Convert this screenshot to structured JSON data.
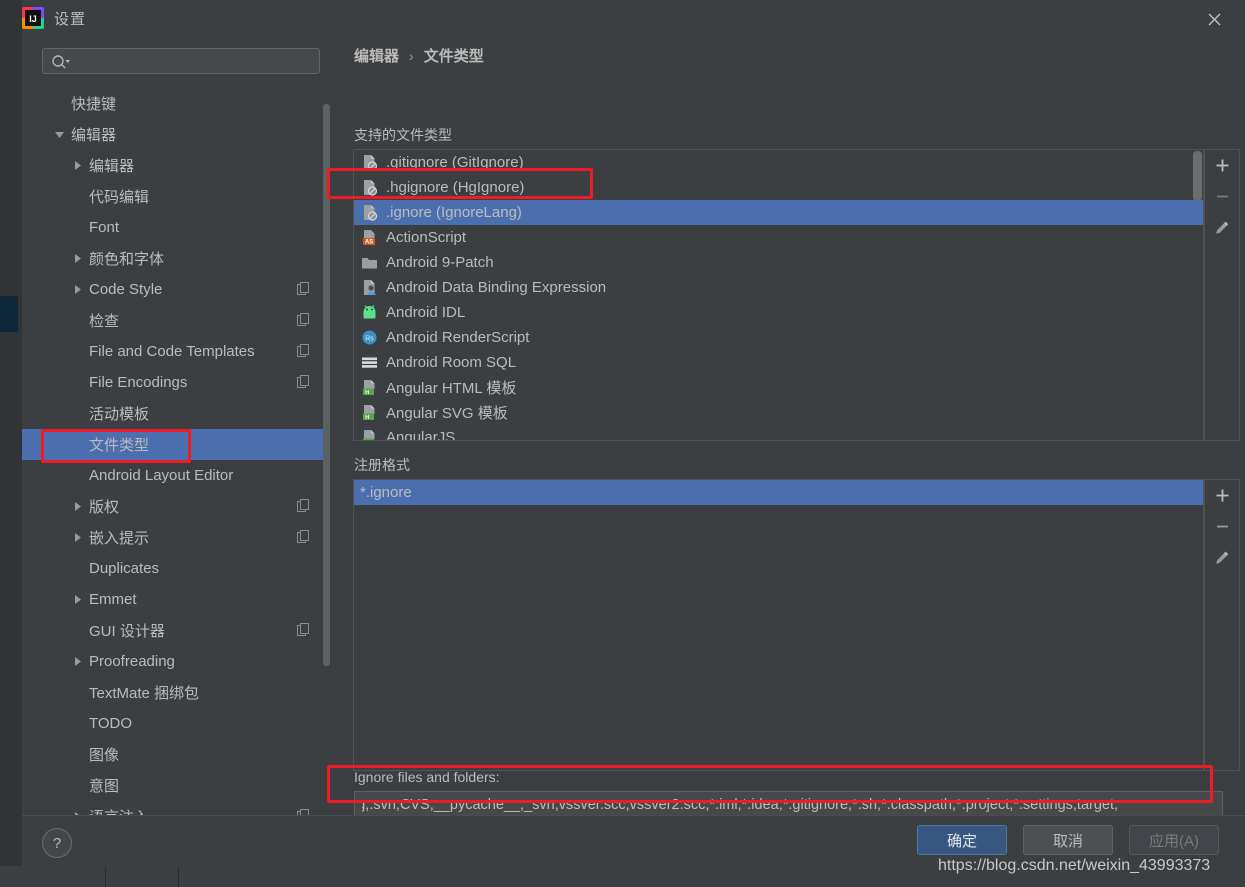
{
  "window": {
    "title": "设置",
    "app_icon": "intellij-idea-icon",
    "close_icon": "close-icon"
  },
  "search": {
    "placeholder": "",
    "value": "",
    "icon": "search-icon"
  },
  "sidebar": {
    "items": [
      {
        "label": "快捷键",
        "level": 0,
        "arrow": "none",
        "badge": false,
        "selected": false
      },
      {
        "label": "编辑器",
        "level": 0,
        "arrow": "down",
        "badge": false,
        "selected": false
      },
      {
        "label": "编辑器",
        "level": 1,
        "arrow": "right",
        "badge": false,
        "selected": false
      },
      {
        "label": "代码编辑",
        "level": 1,
        "arrow": "none",
        "badge": false,
        "selected": false
      },
      {
        "label": "Font",
        "level": 1,
        "arrow": "none",
        "badge": false,
        "selected": false
      },
      {
        "label": "颜色和字体",
        "level": 1,
        "arrow": "right",
        "badge": false,
        "selected": false
      },
      {
        "label": "Code Style",
        "level": 1,
        "arrow": "right",
        "badge": true,
        "selected": false
      },
      {
        "label": "检查",
        "level": 1,
        "arrow": "none",
        "badge": true,
        "selected": false
      },
      {
        "label": "File and Code Templates",
        "level": 1,
        "arrow": "none",
        "badge": true,
        "selected": false
      },
      {
        "label": "File Encodings",
        "level": 1,
        "arrow": "none",
        "badge": true,
        "selected": false
      },
      {
        "label": "活动模板",
        "level": 1,
        "arrow": "none",
        "badge": false,
        "selected": false
      },
      {
        "label": "文件类型",
        "level": 1,
        "arrow": "none",
        "badge": false,
        "selected": true
      },
      {
        "label": "Android Layout Editor",
        "level": 1,
        "arrow": "none",
        "badge": false,
        "selected": false
      },
      {
        "label": "版权",
        "level": 1,
        "arrow": "right",
        "badge": true,
        "selected": false
      },
      {
        "label": "嵌入提示",
        "level": 1,
        "arrow": "right",
        "badge": true,
        "selected": false
      },
      {
        "label": "Duplicates",
        "level": 1,
        "arrow": "none",
        "badge": false,
        "selected": false
      },
      {
        "label": "Emmet",
        "level": 1,
        "arrow": "right",
        "badge": false,
        "selected": false
      },
      {
        "label": "GUI 设计器",
        "level": 1,
        "arrow": "none",
        "badge": true,
        "selected": false
      },
      {
        "label": "Proofreading",
        "level": 1,
        "arrow": "right",
        "badge": false,
        "selected": false
      },
      {
        "label": "TextMate 捆绑包",
        "level": 1,
        "arrow": "none",
        "badge": false,
        "selected": false
      },
      {
        "label": "TODO",
        "level": 1,
        "arrow": "none",
        "badge": false,
        "selected": false
      },
      {
        "label": "图像",
        "level": 1,
        "arrow": "none",
        "badge": false,
        "selected": false
      },
      {
        "label": "意图",
        "level": 1,
        "arrow": "none",
        "badge": false,
        "selected": false
      },
      {
        "label": "语言注入",
        "level": 1,
        "arrow": "right",
        "badge": true,
        "selected": false
      }
    ]
  },
  "content": {
    "breadcrumb": {
      "parent": "编辑器",
      "separator": "›",
      "current": "文件类型"
    },
    "supported_label": "支持的文件类型",
    "file_types": [
      {
        "name": ".gitignore (GitIgnore)",
        "icon": "ignore-file-icon",
        "selected": false
      },
      {
        "name": ".hgignore (HgIgnore)",
        "icon": "ignore-file-icon",
        "selected": false
      },
      {
        "name": ".ignore (IgnoreLang)",
        "icon": "ignore-file-icon",
        "selected": true
      },
      {
        "name": "ActionScript",
        "icon": "actionscript-icon",
        "selected": false
      },
      {
        "name": "Android 9-Patch",
        "icon": "folder-icon",
        "selected": false
      },
      {
        "name": "Android Data Binding Expression",
        "icon": "data-binding-icon",
        "selected": false
      },
      {
        "name": "Android IDL",
        "icon": "android-robot-icon",
        "selected": false
      },
      {
        "name": "Android RenderScript",
        "icon": "renderscript-icon",
        "selected": false
      },
      {
        "name": "Android Room SQL",
        "icon": "sql-table-icon",
        "selected": false
      },
      {
        "name": "Angular HTML 模板",
        "icon": "angular-html-icon",
        "selected": false
      },
      {
        "name": "Angular SVG 模板",
        "icon": "angular-svg-icon",
        "selected": false
      },
      {
        "name": "AngularJS",
        "icon": "angular-js-icon",
        "selected": false
      }
    ],
    "patterns_label": "注册格式",
    "patterns": [
      {
        "value": "*.ignore",
        "selected": true
      }
    ],
    "ignore_label": "Ignore files and folders:",
    "ignore_value": "CVS;.DS_Store;.git;.hg;.svn;CVS;__pycache__;_svn;vssver.scc;vssver2.scc;*.iml;*.idea;*.gitignore;*.sh;*.classpath;*.project;*.settings;target;",
    "toolbar": {
      "add_label": "+",
      "remove_label": "−",
      "edit_label": "edit-pencil-icon"
    }
  },
  "footer": {
    "help_label": "?",
    "ok_label": "确定",
    "cancel_label": "取消",
    "apply_label": "应用(A)"
  },
  "watermark": {
    "text": "https://blog.csdn.net/weixin_43993373"
  },
  "colors": {
    "window_bg": "#3c3f41",
    "selection_blue": "#4b6eaf",
    "pattern_selection_blue": "#4b6eaf",
    "text": "#bbbbbb",
    "annotation_red": "#ee1c25",
    "ok_button": "#365880"
  }
}
